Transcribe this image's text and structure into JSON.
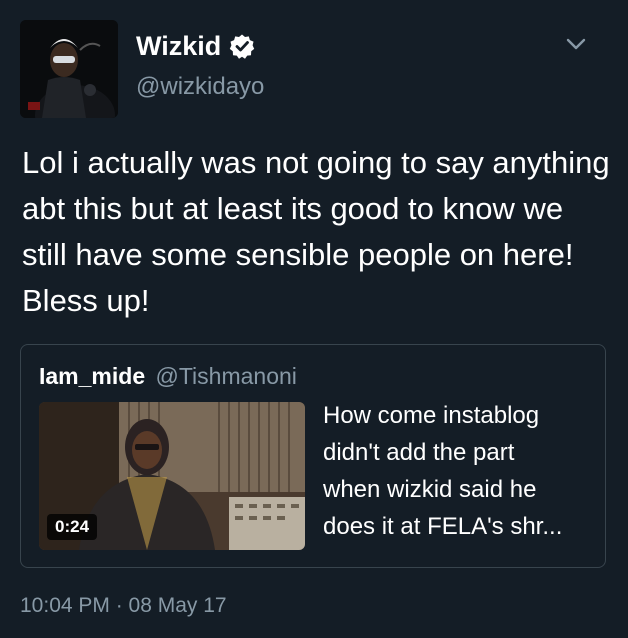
{
  "author": {
    "display_name": "Wizkid",
    "handle": "@wizkidayo",
    "verified": true,
    "avatar": "avatar-image"
  },
  "tweet": {
    "text": "Lol i actually was not going to say anything abt this but at least its good to know we still have some sensible people on here! Bless up!",
    "timestamp": "10:04 PM · 08 May 17"
  },
  "quoted_tweet": {
    "name": "Iam_mide",
    "handle": "@Tishmanoni",
    "video_duration": "0:24",
    "text_lines": [
      "How come instablog",
      "didn't add the part",
      "when wizkid said he",
      "does it at FELA's shr..."
    ]
  },
  "icons": {
    "verified": "verified-badge-icon",
    "menu": "chevron-down-icon"
  },
  "colors": {
    "background": "#141d26",
    "text_primary": "#ffffff",
    "text_secondary": "#8899a6",
    "border": "#38444d",
    "verified_badge": "#ffffff"
  }
}
